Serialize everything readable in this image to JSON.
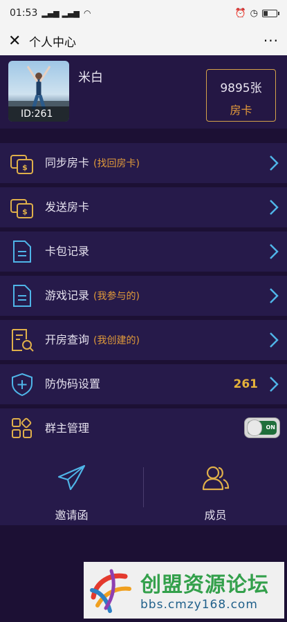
{
  "status_bar": {
    "time": "01:53",
    "signal": "ⁿᵢₗ ⁿᵢₗ",
    "battery_level": 0.3
  },
  "nav": {
    "close": "✕",
    "title": "个人中心",
    "more": "···"
  },
  "profile": {
    "username": "米白",
    "user_id": "ID:261",
    "card_count": "9895张",
    "card_label": "房卡"
  },
  "menu": [
    {
      "label": "同步房卡",
      "hint": "(找回房卡)",
      "icon": "coins-icon"
    },
    {
      "label": "发送房卡",
      "hint": "",
      "icon": "coins-icon"
    },
    {
      "label": "卡包记录",
      "hint": "",
      "icon": "document-icon"
    },
    {
      "label": "游戏记录",
      "hint": "(我参与的)",
      "icon": "document-icon"
    },
    {
      "label": "开房查询",
      "hint": "(我创建的)",
      "icon": "search-document-icon"
    },
    {
      "label": "防伪码设置",
      "hint": "",
      "value": "261",
      "icon": "shield-plus-icon"
    },
    {
      "label": "群主管理",
      "hint": "",
      "toggle": "ON",
      "icon": "grid-icon"
    }
  ],
  "bottom": {
    "invite": "邀请函",
    "members": "成员"
  },
  "watermark": {
    "title": "创盟资源论坛",
    "url": "bbs.cmzy168.com"
  },
  "colors": {
    "bg": "#1c1034",
    "row": "#261a4a",
    "accent": "#e09a3a",
    "icon_gold": "#e0b04a",
    "icon_blue": "#4fb5e8"
  }
}
